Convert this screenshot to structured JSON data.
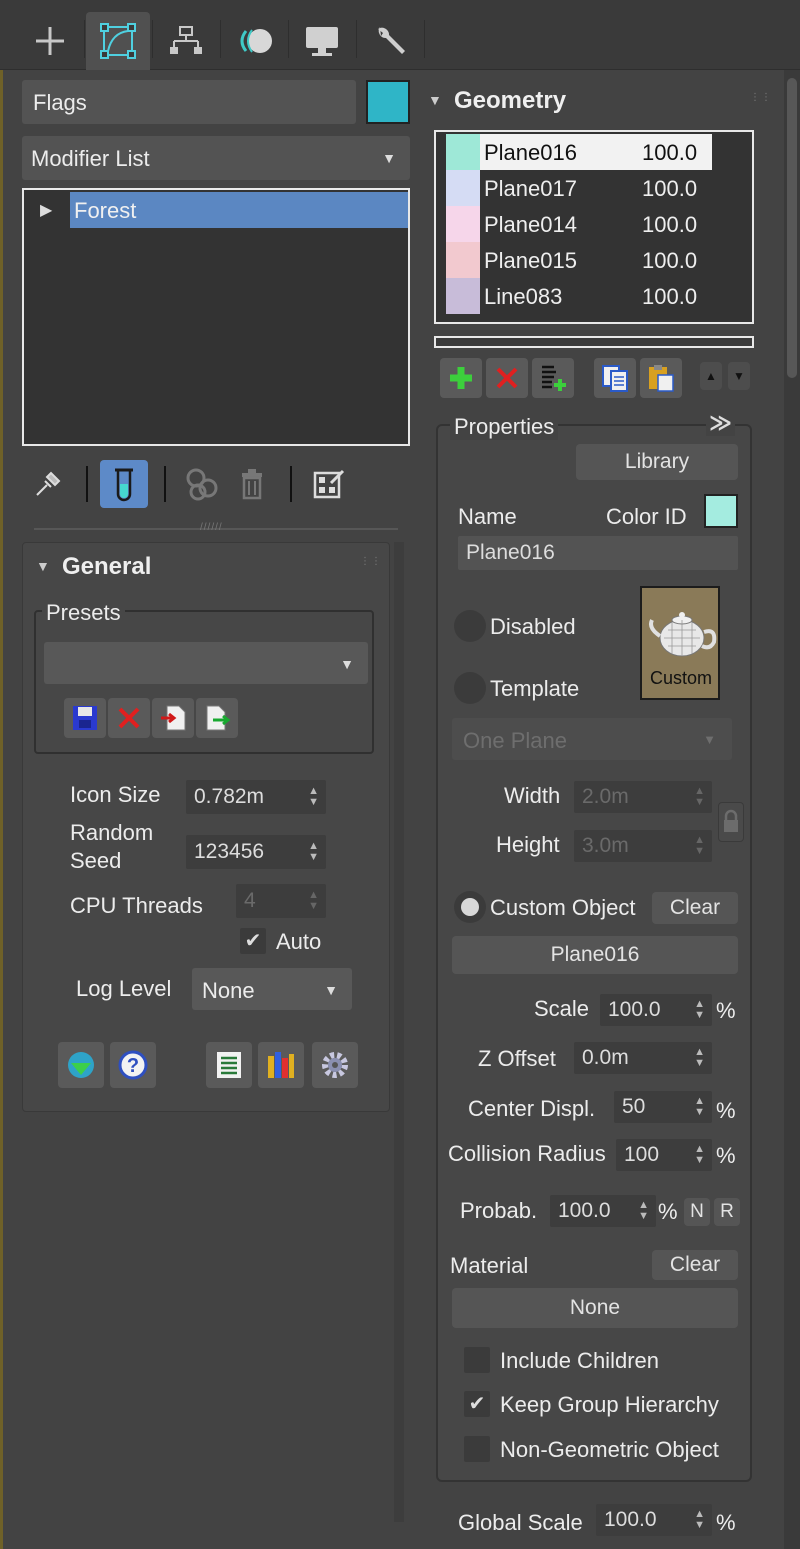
{
  "top_tabs": [
    {
      "name": "create"
    },
    {
      "name": "modify"
    },
    {
      "name": "hierarchy"
    },
    {
      "name": "motion"
    },
    {
      "name": "display"
    },
    {
      "name": "utilities"
    }
  ],
  "left": {
    "flags_label": "Flags",
    "flags_color": "#2fb5c7",
    "modifier_list_label": "Modifier List",
    "stack_item": "Forest",
    "general": {
      "title": "General",
      "presets_label": "Presets",
      "presets_value": "",
      "icon_size_label": "Icon Size",
      "icon_size_value": "0.782m",
      "random_seed_label_1": "Random",
      "random_seed_label_2": "Seed",
      "random_seed_value": "123456",
      "cpu_threads_label": "CPU Threads",
      "cpu_threads_value": "4",
      "auto_label": "Auto",
      "auto_checked": true,
      "log_level_label": "Log Level",
      "log_level_value": "None"
    }
  },
  "right": {
    "geometry_title": "Geometry",
    "geometry_list": [
      {
        "name": "Plane016",
        "value": "100.0",
        "color": "#9ee8d7",
        "selected": true
      },
      {
        "name": "Plane017",
        "value": "100.0",
        "color": "#d5dcf4",
        "selected": false
      },
      {
        "name": "Plane014",
        "value": "100.0",
        "color": "#f6d6ea",
        "selected": false
      },
      {
        "name": "Plane015",
        "value": "100.0",
        "color": "#f2c9cf",
        "selected": false
      },
      {
        "name": "Line083",
        "value": "100.0",
        "color": "#c8bcd9",
        "selected": false
      }
    ],
    "properties": {
      "title": "Properties",
      "library_label": "Library",
      "name_label": "Name",
      "color_id_label": "Color ID",
      "color_id_color": "#a4ece0",
      "name_value": "Plane016",
      "disabled_label": "Disabled",
      "template_label": "Template",
      "thumb_caption": "Custom",
      "plane_type_value": "One Plane",
      "width_label": "Width",
      "width_value": "2.0m",
      "height_label": "Height",
      "height_value": "3.0m",
      "custom_object_label": "Custom Object",
      "clear_label": "Clear",
      "custom_object_value": "Plane016",
      "scale_label": "Scale",
      "scale_value": "100.0",
      "z_offset_label": "Z Offset",
      "z_offset_value": "0.0m",
      "center_displ_label": "Center Displ.",
      "center_displ_value": "50",
      "collision_radius_label": "Collision Radius",
      "collision_radius_value": "100",
      "probab_label": "Probab.",
      "probab_value": "100.0",
      "n_label": "N",
      "r_label": "R",
      "pct": "%",
      "material_label": "Material",
      "material_clear_label": "Clear",
      "material_value": "None",
      "include_children_label": "Include Children",
      "include_children_checked": false,
      "keep_group_label": "Keep Group Hierarchy",
      "keep_group_checked": true,
      "non_geometric_label": "Non-Geometric Object",
      "non_geometric_checked": false
    },
    "global_scale_label": "Global Scale",
    "global_scale_value": "100.0"
  }
}
